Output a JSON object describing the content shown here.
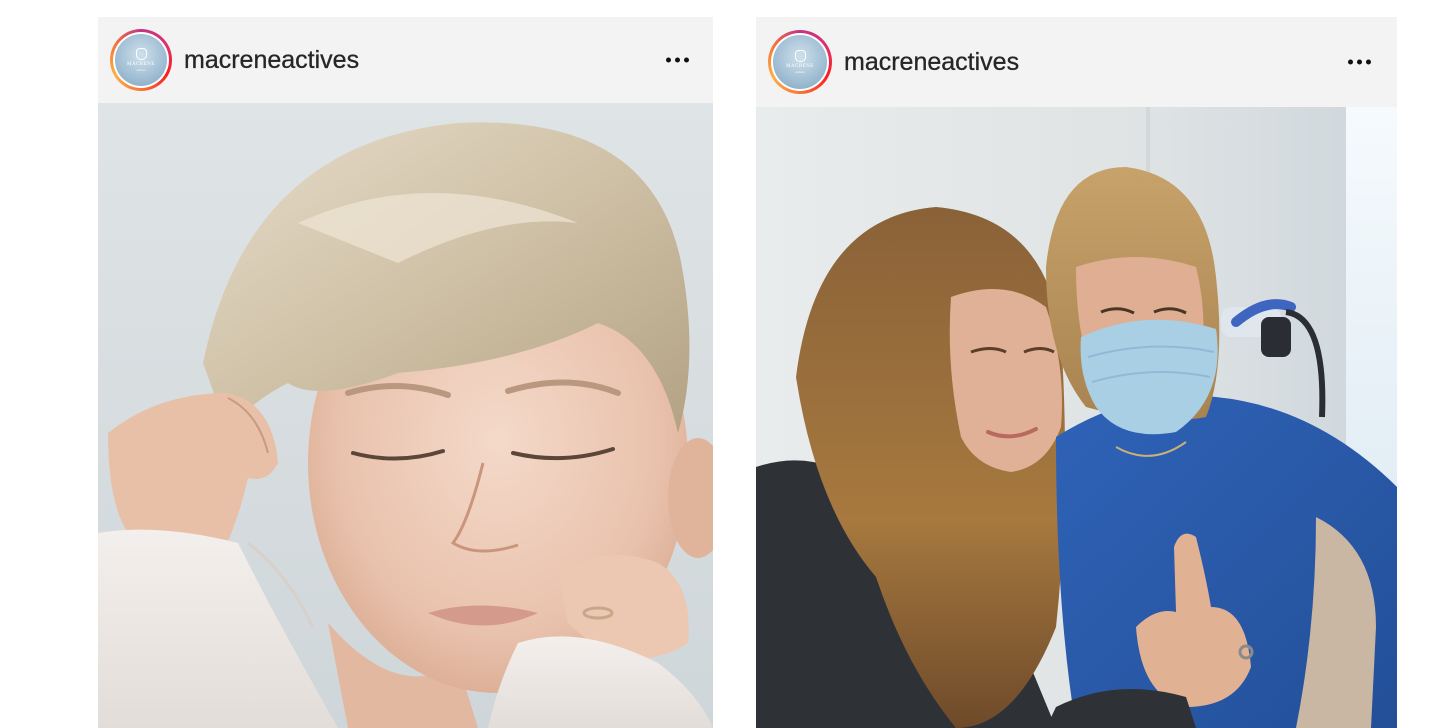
{
  "posts": [
    {
      "username": "macreneactives",
      "avatar_text": {
        "brand": "MACRENE",
        "sub": "actives"
      },
      "more_icon": "more-horizontal-icon"
    },
    {
      "username": "macreneactives",
      "avatar_text": {
        "brand": "MACRENE",
        "sub": "actives"
      },
      "more_icon": "more-horizontal-icon"
    }
  ],
  "colors": {
    "header_bg": "#f3f3f3",
    "username": "#262626",
    "story_ring": [
      "#c13584",
      "#e1306c",
      "#fd1d1d",
      "#f77737",
      "#fcaf45"
    ]
  }
}
